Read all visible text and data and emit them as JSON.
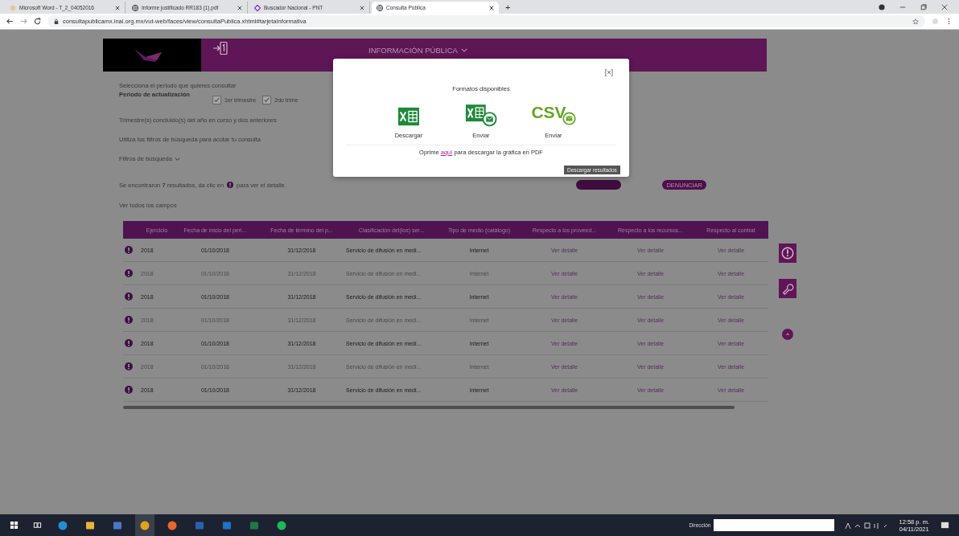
{
  "browser": {
    "tabs": [
      {
        "title": "Microsoft Word - T_2_04052016",
        "kind": "word",
        "selected": false
      },
      {
        "title": "Informe justificado RR183 (1).pdf",
        "kind": "globe",
        "selected": false
      },
      {
        "title": "Buscador Nacional - PNT",
        "kind": "diamond",
        "selected": false
      },
      {
        "title": "Consulta Pública",
        "kind": "globe",
        "selected": true
      }
    ],
    "new_tab": "+",
    "url": "consultapublicamx.inai.org.mx/vut-web/faces/view/consultaPublica.xhtml#tarjetaInformativa"
  },
  "header": {
    "nav": "INFORMACIÓN PÚBLICA"
  },
  "filters": {
    "prompt": "Selecciona el periodo que quieres consultar",
    "period_label": "Periodo de actualización",
    "quarters": [
      {
        "label": "1er trimestre",
        "checked": true
      },
      {
        "label": "2do trime",
        "checked": true
      }
    ],
    "note": "Trimestre(s) concluido(s) del año en curso y dos anteriores",
    "hint": "Utiliza los filtros de búsqueda para acotar tu consulta",
    "toggle": "Filtros de búsqueda"
  },
  "results": {
    "summary_before": "Se encontraron **7** resultados, da clic en",
    "summary_after": "para ver el detalle.",
    "show_all": "Ver todos los campos",
    "report_button": "DENUNCIAR"
  },
  "table": {
    "columns": [
      "Ejercicio",
      "Fecha de inicio del peri...",
      "Fecha de término del p...",
      "Clasificación del(los) ser...",
      "Tipo de medio (catálogo)",
      "Respecto a los proveed...",
      "Respecto a los recursos...",
      "Respecto al contrat"
    ],
    "rows": [
      {
        "muted": false,
        "cells": [
          "2018",
          "01/10/2018",
          "31/12/2018",
          "Servicio de difusión en medi...",
          "Internet",
          "Ver detalle",
          "Ver detalle",
          "Ver detalle"
        ]
      },
      {
        "muted": true,
        "cells": [
          "2018",
          "01/10/2018",
          "31/12/2018",
          "Servicio de difusión en medi...",
          "Internet",
          "Ver detalle",
          "Ver detalle",
          "Ver detalle"
        ]
      },
      {
        "muted": false,
        "cells": [
          "2018",
          "01/10/2018",
          "31/12/2018",
          "Servicio de difusión en medi...",
          "Internet",
          "Ver detalle",
          "Ver detalle",
          "Ver detalle"
        ]
      },
      {
        "muted": true,
        "cells": [
          "2018",
          "01/10/2018",
          "31/12/2018",
          "Servicio de difusión en medi...",
          "Internet",
          "Ver detalle",
          "Ver detalle",
          "Ver detalle"
        ]
      },
      {
        "muted": false,
        "cells": [
          "2018",
          "01/10/2018",
          "31/12/2018",
          "Servicio de difusión en medi...",
          "Internet",
          "Ver detalle",
          "Ver detalle",
          "Ver detalle"
        ]
      },
      {
        "muted": true,
        "cells": [
          "2018",
          "01/10/2018",
          "31/12/2018",
          "Servicio de difusión en medi...",
          "Internet",
          "Ver detalle",
          "Ver detalle",
          "Ver detalle"
        ]
      },
      {
        "muted": false,
        "cells": [
          "2018",
          "01/10/2018",
          "31/12/2018",
          "Servicio de difusión en medi...",
          "Internet",
          "Ver detalle",
          "Ver detalle",
          "Ver detalle"
        ]
      }
    ]
  },
  "dialog": {
    "close": "[×]",
    "title": "Formatos disponibles",
    "formats": [
      {
        "kind": "excel",
        "label": "Descargar"
      },
      {
        "kind": "excel-mail",
        "label": "Enviar"
      },
      {
        "kind": "csv-mail",
        "mark": "CSV",
        "label": "Enviar"
      }
    ],
    "footer_before": "Oprime",
    "footer_link": "aquí",
    "footer_after": "para descargar la gráfica en PDF"
  },
  "tooltip": "Descargar resultados",
  "taskbar": {
    "apps": [
      {
        "kind": "edge",
        "selected": false
      },
      {
        "kind": "folder",
        "selected": false
      },
      {
        "kind": "people",
        "selected": false
      },
      {
        "kind": "chrome",
        "selected": true
      },
      {
        "kind": "firefox",
        "selected": false
      },
      {
        "kind": "word",
        "selected": false
      },
      {
        "kind": "outlook",
        "selected": false
      },
      {
        "kind": "excel",
        "selected": false
      },
      {
        "kind": "spotify",
        "selected": false
      }
    ],
    "address_label": "Dirección",
    "time": "12:58 p. m.",
    "date": "04/11/2021"
  }
}
